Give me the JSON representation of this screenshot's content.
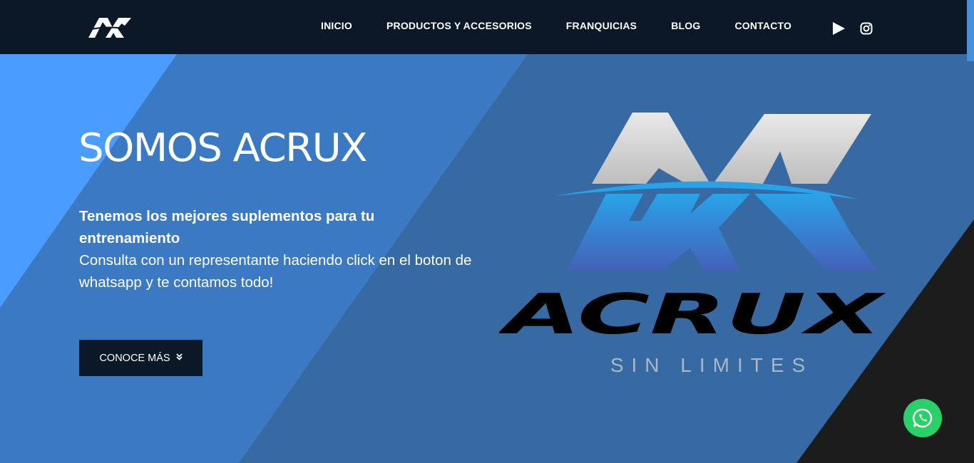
{
  "navbar": {
    "logo_icon": "acrux-ax-logo",
    "links": [
      {
        "label": "INICIO"
      },
      {
        "label": "PRODUCTOS Y ACCESORIOS"
      },
      {
        "label": "FRANQUICIAS"
      },
      {
        "label": "BLOG"
      },
      {
        "label": "CONTACTO"
      }
    ],
    "social": [
      {
        "icon": "play-icon"
      },
      {
        "icon": "instagram-icon"
      }
    ]
  },
  "hero": {
    "title": "SOMOS ACRUX",
    "subtitle_bold": "Tenemos los mejores suplementos para tu entrenamiento",
    "subtitle_text": "Consulta con un representante haciendo click en el boton de whatsapp y te contamos todo!",
    "cta_label": "CONOCE MÁS",
    "cta_icon": "double-chevron-down-icon"
  },
  "brand": {
    "wordmark": "ACRUX",
    "tagline": "SIN LIMITES"
  },
  "whatsapp": {
    "icon": "whatsapp-icon"
  },
  "colors": {
    "navbar": "#0c1827",
    "hero_light": "#4a9cff",
    "hero_mid": "#3b7ac2",
    "hero_dark": "#376aa3",
    "corner": "#1c1c1c",
    "whatsapp": "#2ad168"
  }
}
